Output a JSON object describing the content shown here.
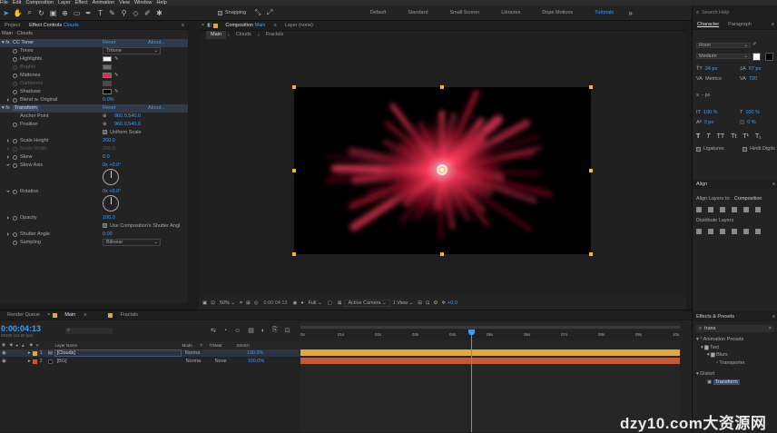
{
  "menu": [
    "File",
    "Edit",
    "Composition",
    "Layer",
    "Effect",
    "Animation",
    "View",
    "Window",
    "Help"
  ],
  "toolbar": {
    "snapping_label": "Snapping",
    "workspaces": [
      "Default",
      "Standard",
      "Small Screen",
      "Libraries",
      "Dope Motions",
      "Tutorials"
    ],
    "active_workspace": "Tutorials",
    "search_placeholder": "Search Help"
  },
  "effect_controls": {
    "tabs": {
      "project": "Project",
      "effect_controls": "Effect Controls",
      "layer_name": "Clouds"
    },
    "breadcrumb": "Main · Clouds",
    "cc_toner": {
      "name": "CC Toner",
      "reset": "Reset",
      "about": "About...",
      "tones_label": "Tones",
      "tones_value": "Tritone",
      "highlights_label": "Highlights",
      "brights_label": "Brights",
      "midtones_label": "Midtones",
      "darktones_label": "Darktones",
      "shadows_label": "Shadows",
      "blend_label": "Blend w. Original",
      "blend_value": "0.0%",
      "colors": {
        "highlights": "#f2f2f2",
        "brights": "#c9c9c9",
        "midtones": "#e0264a",
        "darktones": "#7a7a7a",
        "shadows": "#000000"
      }
    },
    "transform": {
      "name": "Transform",
      "reset": "Reset",
      "about": "About...",
      "anchor_label": "Anchor Point",
      "anchor_value": "960.0,540.0",
      "position_label": "Position",
      "position_value": "960.0,540.0",
      "uniform_scale_label": "Uniform Scale",
      "scale_height_label": "Scale Height",
      "scale_height_value": "200.0",
      "scale_width_label": "Scale Width",
      "scale_width_value": "200.0",
      "skew_label": "Skew",
      "skew_value": "0.0",
      "skew_axis_label": "Skew Axis",
      "skew_axis_value": "0x +0.0°",
      "rotation_label": "Rotation",
      "rotation_value": "0x +0.0°",
      "opacity_label": "Opacity",
      "opacity_value": "100.0",
      "shutter_cb_label": "Use Composition's Shutter Angl",
      "shutter_angle_label": "Shutter Angle",
      "shutter_angle_value": "0.00",
      "sampling_label": "Sampling",
      "sampling_value": "Bilinear"
    }
  },
  "composition": {
    "tabs": {
      "composition": "Composition",
      "comp_name": "Main",
      "layer": "Layer (none)"
    },
    "breadcrumbs": [
      "Main",
      "Clouds",
      "Fractals"
    ],
    "viewer": {
      "zoom": "50%",
      "timecode": "0:00:04:13",
      "resolution": "Full",
      "camera": "Active Camera",
      "views": "1 View",
      "exposure": "+0.0"
    },
    "flare_colors": {
      "core": "#ffd7dd",
      "mid": "#ff3b5c",
      "outer": "#8a0a22"
    }
  },
  "character": {
    "tabs": [
      "Character",
      "Paragraph"
    ],
    "font": "Roon",
    "style": "Medium",
    "size": "34 px",
    "leading": "67 px",
    "kerning": "Metrics",
    "tracking": "720",
    "stroke": "- px",
    "vert_scale": "100 %",
    "horiz_scale": "100 %",
    "baseline": "0 px",
    "tsume": "0 %",
    "ligatures_label": "Ligatures",
    "hindi_label": "Hindi Digits",
    "styles": [
      "T",
      "T",
      "TT",
      "Tt",
      "T¹",
      "T₁"
    ]
  },
  "align": {
    "title": "Align",
    "align_to_label": "Align Layers to:",
    "align_to_value": "Composition",
    "distribute_label": "Distribute Layers"
  },
  "effects_presets": {
    "title": "Effects & Presets",
    "search_value": "trans",
    "tree": [
      "* Animation Presets",
      "Text",
      "Blurs",
      "Transporter",
      "Distort",
      "Transform"
    ]
  },
  "timeline": {
    "tabs": [
      "Render Queue",
      "Main",
      "Fractals"
    ],
    "timecode": "0:00:04:13",
    "timecode_sub": "00109 (24.00 fps)",
    "columns": [
      "Layer Name",
      "Mode",
      "T",
      "TrkMat",
      "Stretch"
    ],
    "layers": [
      {
        "num": "1",
        "name": "[Clouds]",
        "mode": "Norma",
        "trkmat": "",
        "stretch": "100.0%",
        "color": "#e3a83a"
      },
      {
        "num": "2",
        "name": "[BG]",
        "mode": "Norma",
        "trkmat": "None",
        "stretch": "100.0%",
        "color": "#c25a3a"
      }
    ],
    "ruler": [
      "0s",
      "01s",
      "02s",
      "03s",
      "04s",
      "05s",
      "06s",
      "07s",
      "08s",
      "09s",
      "10s"
    ],
    "playhead_fraction": 0.45
  },
  "watermark": "dzy10.com大资源网"
}
